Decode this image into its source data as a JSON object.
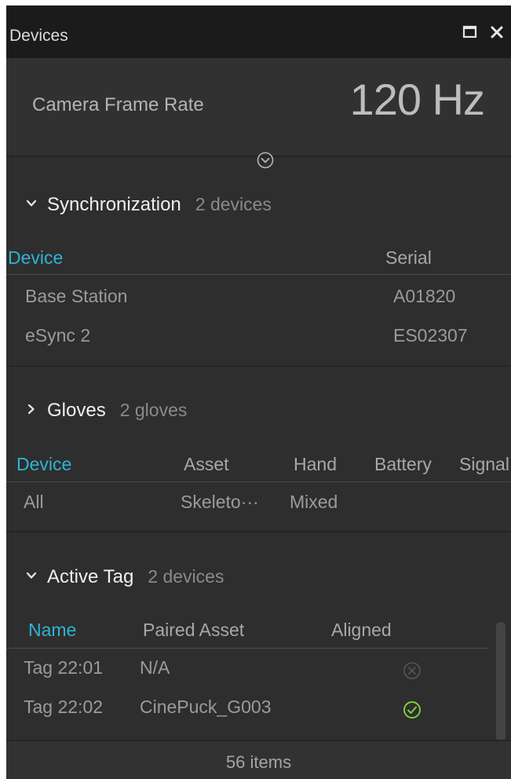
{
  "window": {
    "title": "Devices",
    "restore_icon": "window-restore-icon",
    "close_icon": "close-icon"
  },
  "frame_rate": {
    "label": "Camera Frame Rate",
    "value": "120 Hz"
  },
  "colors": {
    "accent": "#2fb3d6",
    "ok_green": "#7fd13a",
    "background": "#2e2e2e",
    "titlebar": "#1b1b1b"
  },
  "sections": {
    "sync": {
      "title": "Synchronization",
      "count": "2 devices",
      "expanded": true,
      "columns": [
        "Device",
        "Serial"
      ],
      "rows": [
        {
          "device": "Base Station",
          "serial": "A01820"
        },
        {
          "device": "eSync 2",
          "serial": "ES02307"
        }
      ]
    },
    "gloves": {
      "title": "Gloves",
      "count": "2 gloves",
      "expanded": false,
      "columns": [
        "Device",
        "Asset",
        "Hand",
        "Battery",
        "Signal"
      ],
      "rows": [
        {
          "device": "All",
          "asset": "Skeleto···",
          "hand": "Mixed",
          "battery": "",
          "signal": ""
        }
      ]
    },
    "active_tag": {
      "title": "Active Tag",
      "count": "2 devices",
      "expanded": true,
      "columns": [
        "Name",
        "Paired Asset",
        "Aligned"
      ],
      "rows": [
        {
          "name": "Tag 22:01",
          "paired_asset": "N/A",
          "aligned": false,
          "aligned_icon": "x-circle-icon"
        },
        {
          "name": "Tag 22:02",
          "paired_asset": "CinePuck_G003",
          "aligned": true,
          "aligned_icon": "check-circle-icon"
        }
      ]
    }
  },
  "footer": {
    "item_count": "56 items"
  }
}
